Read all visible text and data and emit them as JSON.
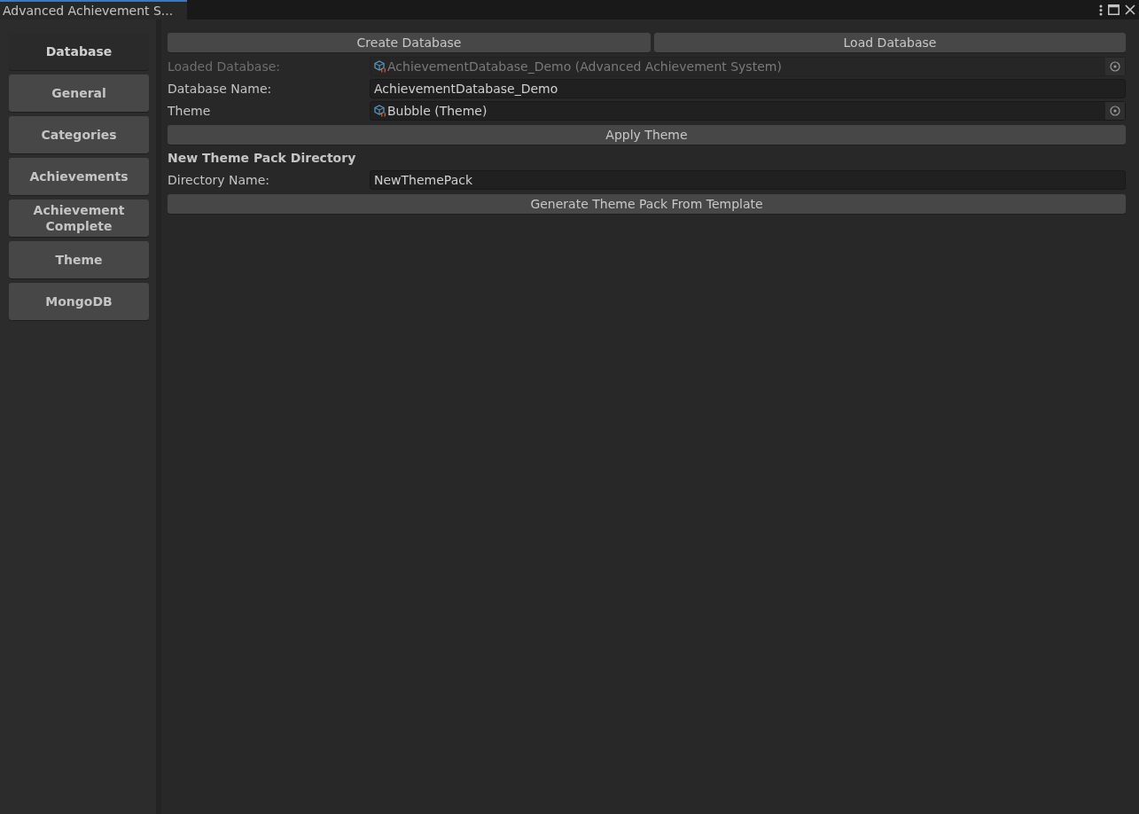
{
  "window": {
    "title": "Advanced Achievement S..."
  },
  "sidebar": {
    "items": [
      {
        "label": "Database",
        "selected": true
      },
      {
        "label": "General",
        "selected": false
      },
      {
        "label": "Categories",
        "selected": false
      },
      {
        "label": "Achievements",
        "selected": false
      },
      {
        "label": "Achievement Complete",
        "selected": false
      },
      {
        "label": "Theme",
        "selected": false
      },
      {
        "label": "MongoDB",
        "selected": false
      }
    ]
  },
  "top_buttons": [
    "Create Database",
    "Load Database"
  ],
  "rows": [
    {
      "kind": "object",
      "label": "Loaded Database:",
      "value": "AchievementDatabase_Demo (Advanced Achievement System)",
      "disabled": true
    },
    {
      "kind": "text",
      "label": "Database Name:",
      "value": "AchievementDatabase_Demo",
      "disabled": false
    },
    {
      "kind": "object",
      "label": "Theme",
      "value": "Bubble (Theme)",
      "disabled": false
    },
    {
      "kind": "button",
      "label": "Apply Theme"
    },
    {
      "kind": "heading",
      "label": "New Theme Pack Directory"
    },
    {
      "kind": "text",
      "label": "Directory Name:",
      "value": "NewThemePack",
      "disabled": false
    },
    {
      "kind": "button",
      "label": "Generate Theme Pack From Template"
    }
  ]
}
